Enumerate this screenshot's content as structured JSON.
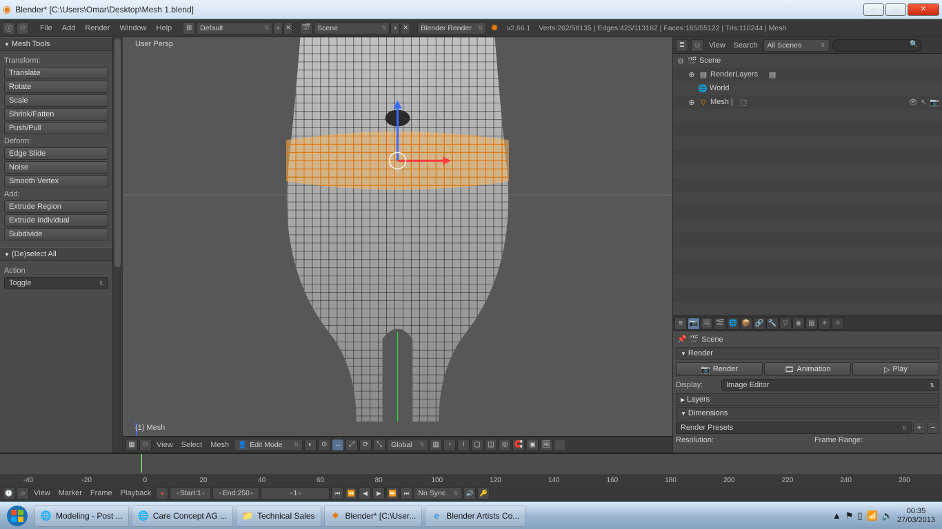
{
  "window": {
    "title": "Blender* [C:\\Users\\Omar\\Desktop\\Mesh 1.blend]"
  },
  "topmenu": {
    "file": "File",
    "add": "Add",
    "render": "Render",
    "window": "Window",
    "help": "Help",
    "layout_dropdown": "Default",
    "scene_dropdown": "Scene",
    "engine_dropdown": "Blender Render",
    "version": "v2.66.1",
    "stats": "Verts:262/58135 | Edges:425/113162 | Faces:165/55122 | Tris:110244 | Mesh"
  },
  "toolshelf": {
    "title": "Mesh Tools",
    "transform_label": "Transform:",
    "transform": [
      "Translate",
      "Rotate",
      "Scale",
      "Shrink/Fatten",
      "Push/Pull"
    ],
    "deform_label": "Deform:",
    "deform": [
      "Edge Slide",
      "Noise",
      "Smooth Vertex"
    ],
    "add_label": "Add:",
    "add": [
      "Extrude Region",
      "Extrude Individual",
      "Subdivide"
    ],
    "deselect_title": "(De)select All",
    "action_label": "Action",
    "action_value": "Toggle"
  },
  "viewport": {
    "persp": "User Persp",
    "mesh_name": "(1) Mesh",
    "header": {
      "view": "View",
      "select": "Select",
      "mesh": "Mesh",
      "mode": "Edit Mode",
      "orientation": "Global"
    }
  },
  "outliner": {
    "view": "View",
    "search": "Search",
    "filter": "All Scenes",
    "items": {
      "scene": "Scene",
      "renderlayers": "RenderLayers",
      "world": "World",
      "mesh": "Mesh"
    }
  },
  "props": {
    "breadcrumb": "Scene",
    "render_panel": "Render",
    "render_btn": "Render",
    "animation_btn": "Animation",
    "play_btn": "Play",
    "display_label": "Display:",
    "display_value": "Image Editor",
    "layers_panel": "Layers",
    "dimensions_panel": "Dimensions",
    "presets_label": "Render Presets",
    "resolution_label": "Resolution:",
    "framerange_label": "Frame Range:"
  },
  "timeline": {
    "ticks": [
      "-40",
      "-20",
      "0",
      "20",
      "40",
      "60",
      "80",
      "100",
      "120",
      "140",
      "160",
      "180",
      "200",
      "220",
      "240",
      "260"
    ],
    "view": "View",
    "marker": "Marker",
    "frame": "Frame",
    "playback": "Playback",
    "start_label": "Start:",
    "start_value": "1",
    "end_label": "End:",
    "end_value": "250",
    "current": "1",
    "sync": "No Sync"
  },
  "taskbar": {
    "items": [
      {
        "icon": "chrome",
        "label": "Modeling - Post ..."
      },
      {
        "icon": "chrome",
        "label": "Care Concept AG ..."
      },
      {
        "icon": "folder",
        "label": "Technical Sales"
      },
      {
        "icon": "blender",
        "label": "Blender* [C:\\User..."
      },
      {
        "icon": "ie",
        "label": "Blender Artists Co..."
      }
    ],
    "tray": {
      "time": "00:35",
      "date": "27/03/2013"
    }
  }
}
